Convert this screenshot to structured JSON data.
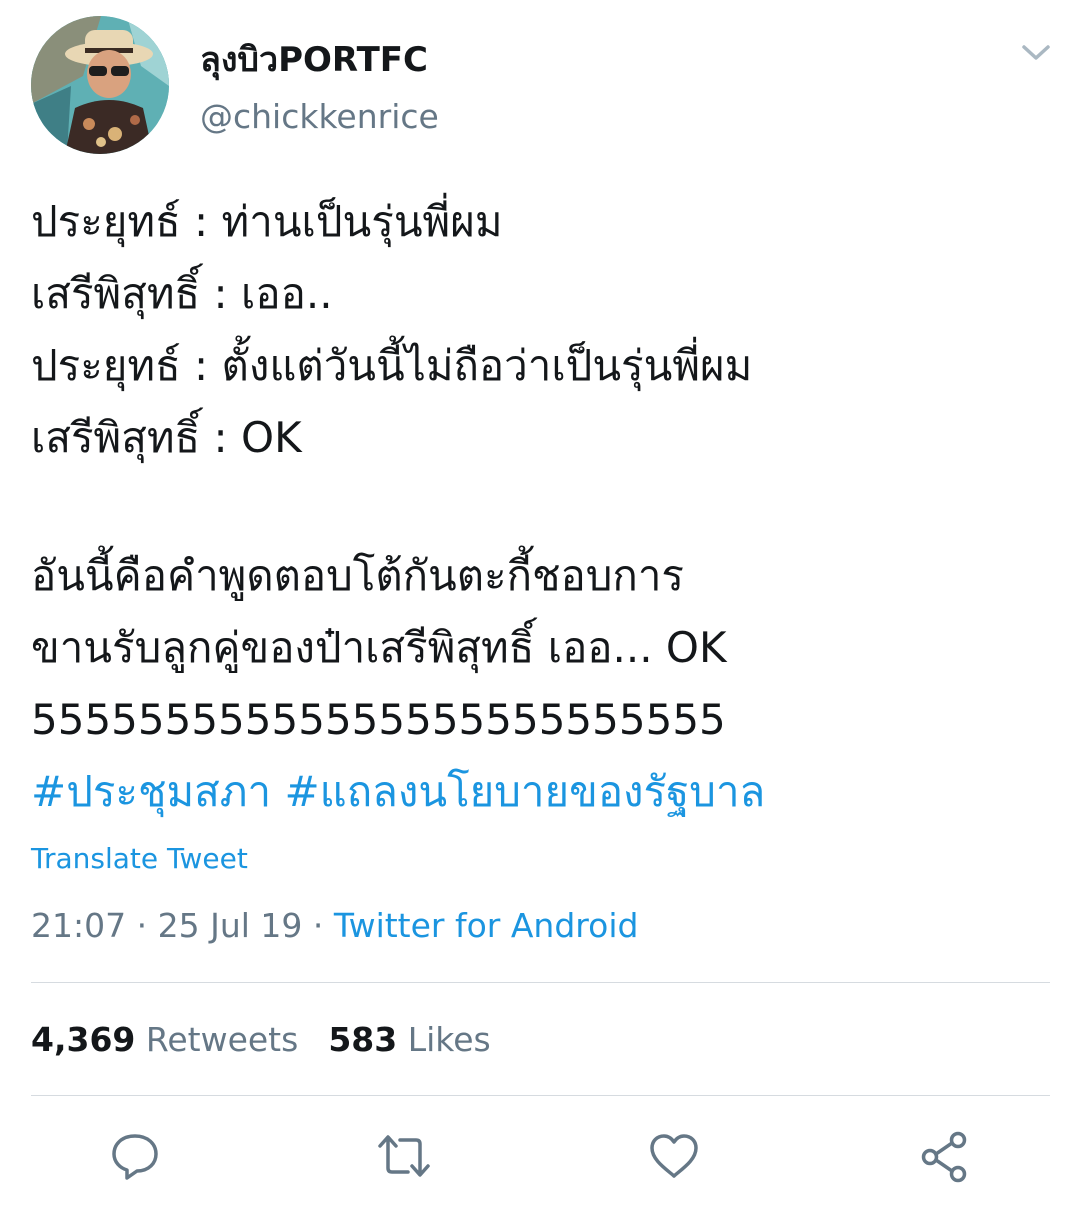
{
  "tweet": {
    "author": {
      "display_name": "ลุงบิวPORTFC",
      "handle": "@chickkenrice"
    },
    "lines": [
      "ประยุทธ์ : ท่านเป็นรุ่นพี่ผม",
      "เสรีพิสุทธิ์ : เออ..",
      "ประยุทธ์ : ตั้งแต่วันนี้ไม่ถือว่าเป็นรุ่นพี่ผม",
      "เสรีพิสุทธิ์ : OK",
      "",
      "อันนี้คือคำพูดตอบโต้กันตะกี้ชอบการ",
      "ขานรับลูกคู่ของป๋าเสรีพิสุทธิ์ เออ... OK",
      "55555555555555555555555555"
    ],
    "hashtags": [
      "#ประชุมสภา",
      "#แถลงนโยบายของรัฐบาล"
    ],
    "translate_label": "Translate Tweet",
    "time": "21:07",
    "date": "25 Jul 19",
    "separator": "·",
    "source": "Twitter for Android",
    "stats": {
      "retweets_count": "4,369",
      "retweets_label": "Retweets",
      "likes_count": "583",
      "likes_label": "Likes"
    }
  },
  "icons": {
    "menu": "chevron-down-icon",
    "actions": [
      "reply-icon",
      "retweet-icon",
      "like-icon",
      "share-icon"
    ]
  },
  "colors": {
    "link": "#1b95e0",
    "secondary_text": "#657786",
    "primary_text": "#14171a",
    "divider": "#d6dbe0"
  }
}
